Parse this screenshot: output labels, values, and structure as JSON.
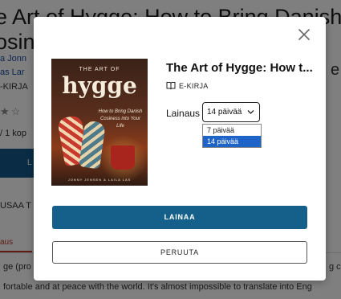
{
  "background": {
    "title_line1": "e Art of Hygge: How to Bring Danish",
    "title_line2": "osin",
    "author_line1": "a Jonn",
    "author_line2": "as Lar",
    "format": "-KIRJA",
    "copies": "/ 1 kop",
    "button_fragment": "L",
    "more_label": "USAA T",
    "tab_label": "aus",
    "para_line1": "ge (pro",
    "para_line2": "fortable and at peace with the world. It's almost impossible to translate into Eng",
    "trailing_fragment": "g c",
    "trailing_fragment2": "e"
  },
  "modal": {
    "close_icon": "close-icon",
    "cover": {
      "top_text": "THE ART OF",
      "word": "hygge",
      "subtitle": "How to Bring Danish Cosiness into Your Life",
      "author": "JONNY JENSEN & LAILA LAS"
    },
    "book_title": "The Art of Hygge: How t...",
    "format_icon": "book-icon",
    "format_label": "E-KIRJA",
    "loan_label": "Lainaus",
    "loan_selected": "14 päivää",
    "loan_options": [
      "7 päivää",
      "14 päivää"
    ],
    "borrow_label": "LAINAA",
    "cancel_label": "PERUUTA",
    "accent_color": "#15608a",
    "selection_color": "#1e64c8"
  }
}
